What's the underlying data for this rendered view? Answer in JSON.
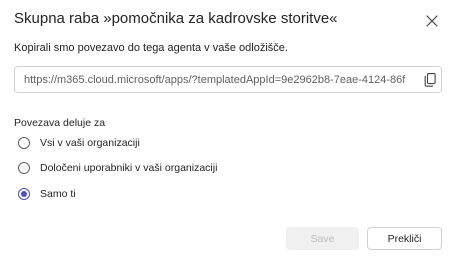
{
  "dialog": {
    "title": "Skupna raba »pomočnika za kadrovske storitve«",
    "subtitle": "Kopirali smo povezavo do tega agenta v vaše odložišče.",
    "link_value": "https://m365.cloud.microsoft/apps/?templatedAppId=9e2962b8-7eae-4124-86f",
    "close_icon": "close-icon",
    "copy_icon": "copy-icon"
  },
  "access": {
    "label": "Povezava deluje za",
    "options": [
      {
        "label": "Vsi v vaši organizaciji",
        "selected": false
      },
      {
        "label": "Določeni uporabniki v vaši organizaciji",
        "selected": false
      },
      {
        "label": "Samo ti",
        "selected": true
      }
    ]
  },
  "buttons": {
    "save": "Save",
    "cancel": "Prekliči"
  },
  "colors": {
    "accent": "#4f52b2",
    "text": "#242424",
    "muted": "#616161",
    "border": "#d1d1d1",
    "disabled_bg": "#f0f0f0",
    "disabled_text": "#bdbdbd"
  }
}
